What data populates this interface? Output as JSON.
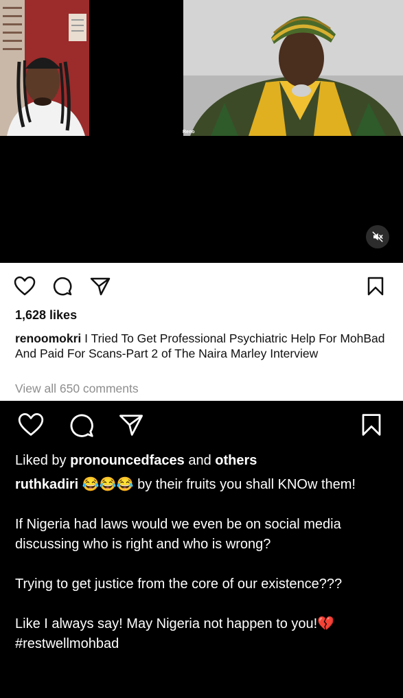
{
  "video": {
    "participant_label": "Reno"
  },
  "post1": {
    "likes": "1,628 likes",
    "username": "renoomokri",
    "caption": " I Tried To Get Professional Psychiatric Help For MohBad And Paid For Scans-Part 2 of The Naira Marley Interview",
    "view_comments": "View all 650 comments"
  },
  "post2": {
    "liked_by_prefix": "Liked by ",
    "liked_by_user": "pronouncedfaces",
    "liked_by_mid": " and ",
    "liked_by_others": "others",
    "comment_user": "ruthkadiri",
    "comment_line1": " 😂😂😂 by their fruits you shall KNOw them!",
    "comment_line2": "If Nigeria had laws would we even be on social media discussing who is right and who is wrong?",
    "comment_line3": "Trying to get justice from the  core of our existence???",
    "comment_line4": "Like I always say! May Nigeria not happen to you!💔",
    "hashtag": "#restwellmohbad"
  },
  "icons": {
    "like": "heart-icon",
    "comment": "comment-icon",
    "share": "share-icon",
    "save": "bookmark-icon",
    "mute": "muted-speaker-icon"
  },
  "colors": {
    "panel_light": "#ffffff",
    "panel_dark": "#000000",
    "muted_text": "#8e8e8e"
  }
}
